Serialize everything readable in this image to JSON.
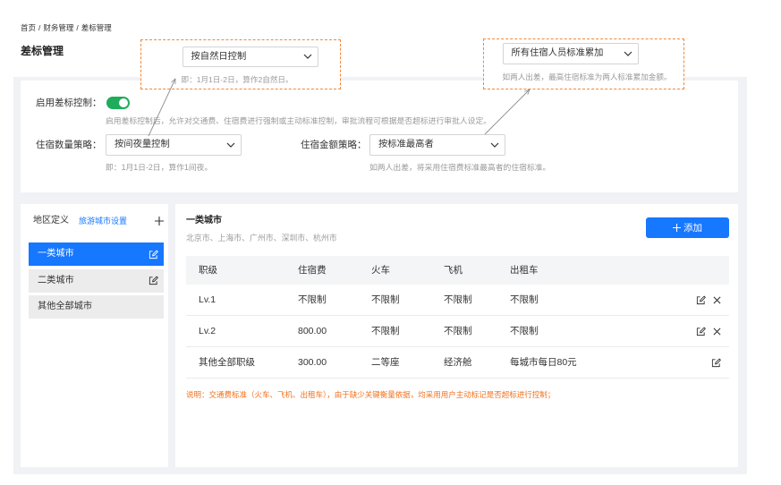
{
  "breadcrumb": {
    "items": [
      "首页",
      "财务管理",
      "差标管理"
    ],
    "separator": "/"
  },
  "page_title": "差标管理",
  "annotations": [
    {
      "select_value": "按自然日控制",
      "hint": "即：1月1日-2日，算作2自然日。"
    },
    {
      "select_value": "所有住宿人员标准累加",
      "hint": "如两人出差，最高住宿标准为两人标准累加金额。"
    }
  ],
  "settings": {
    "enable": {
      "label": "启用差标控制：",
      "on": true,
      "description": "启用差标控制后，允许对交通费、住宿费进行强制或主动标准控制，审批流程可根据是否超标进行审批人设定。"
    },
    "lodging_count": {
      "label": "住宿数量策略：",
      "value": "按间夜量控制",
      "hint": "即：1月1日-2日，算作1间夜。"
    },
    "lodging_amount": {
      "label": "住宿金额策略：",
      "value": "按标准最高者",
      "hint": "如两人出差，将采用住宿费标准最高者的住宿标准。"
    }
  },
  "regions": {
    "title": "地区定义",
    "settings_link": "旅游城市设置",
    "add_icon": "plus-icon",
    "items": [
      {
        "label": "一类城市",
        "selected": true,
        "actions": [
          "edit-icon"
        ]
      },
      {
        "label": "二类城市",
        "selected": false,
        "actions": [
          "edit-icon"
        ]
      },
      {
        "label": "其他全部城市",
        "selected": false,
        "actions": []
      }
    ]
  },
  "detail": {
    "title": "一类城市",
    "cities": "北京市、上海市、广州市、深圳市、杭州市",
    "add_button": {
      "icon": "plus-icon",
      "label": "添加"
    },
    "columns": [
      "职级",
      "住宿费",
      "火车",
      "飞机",
      "出租车"
    ],
    "rows": [
      {
        "cells": [
          "Lv.1",
          "不限制",
          "不限制",
          "不限制",
          "不限制"
        ],
        "actions": [
          "edit-icon",
          "close-icon"
        ]
      },
      {
        "cells": [
          "Lv.2",
          "800.00",
          "不限制",
          "不限制",
          "不限制"
        ],
        "actions": [
          "edit-icon",
          "close-icon"
        ]
      },
      {
        "cells": [
          "其他全部职级",
          "300.00",
          "二等座",
          "经济舱",
          "每城市每日80元"
        ],
        "actions": [
          "edit-icon"
        ]
      }
    ],
    "note": "说明：交通费标准（火车、飞机、出租车），由于缺少关键衡量依据，均采用用户主动标记是否超标进行控制；"
  },
  "icons": {
    "dropdown": "chevron-down-icon",
    "edit": "edit-icon",
    "delete": "close-icon",
    "add": "plus-icon"
  },
  "colors": {
    "primary": "#1677ff",
    "toggle": "#1fad5b",
    "annotation": "#f0883a",
    "note": "#f2711c",
    "muted": "#9a9a9a",
    "canvas": "#f0f2f5",
    "arrow": "#8c8c8c"
  }
}
